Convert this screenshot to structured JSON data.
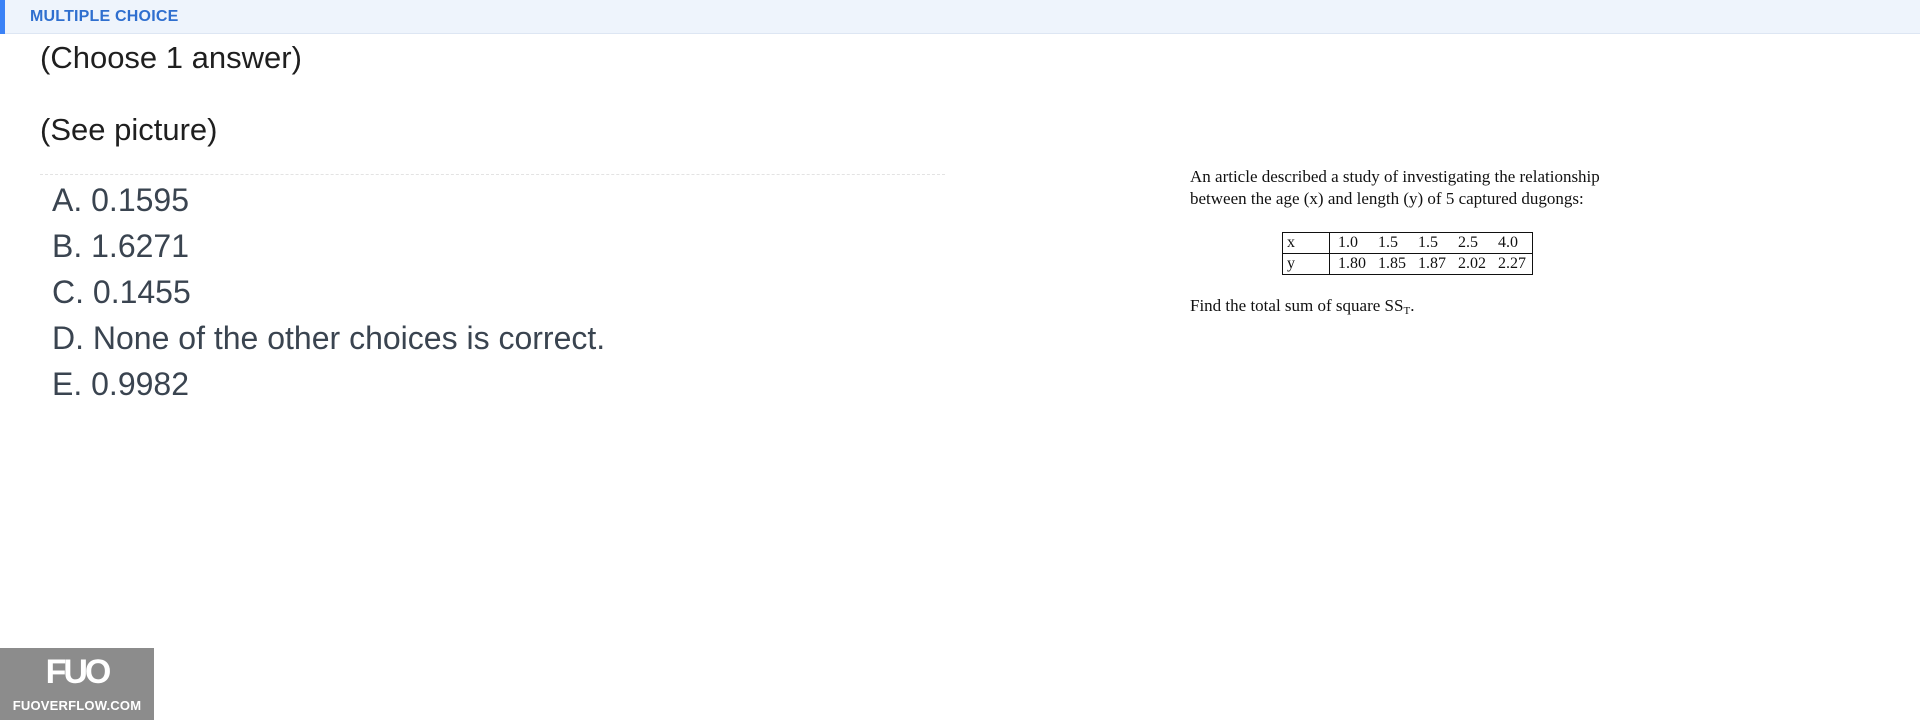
{
  "header": {
    "title": "MULTIPLE CHOICE",
    "accent_color": "#3b82f6"
  },
  "instructions": {
    "choose": "(Choose 1 answer)",
    "see_picture": "(See picture)"
  },
  "options": [
    {
      "label": "A. 0.1595"
    },
    {
      "label": "B. 1.6271"
    },
    {
      "label": "C. 0.1455"
    },
    {
      "label": "D. None of the other choices is correct."
    },
    {
      "label": "E. 0.9982"
    }
  ],
  "question_image": {
    "line1": "An article described a study of investigating the relationship",
    "line2": "between the age (x) and length (y) of 5 captured dugongs:",
    "table": {
      "rows": [
        {
          "var": "x",
          "values": [
            "1.0",
            "1.5",
            "1.5",
            "2.5",
            "4.0"
          ]
        },
        {
          "var": "y",
          "values": [
            "1.80",
            "1.85",
            "1.87",
            "2.02",
            "2.27"
          ]
        }
      ]
    },
    "find_prefix": "Find the total sum of square SS",
    "find_sub": "T",
    "find_suffix": "."
  },
  "watermark": {
    "logo": "FUO",
    "site": "FUOVERFLOW.COM"
  }
}
